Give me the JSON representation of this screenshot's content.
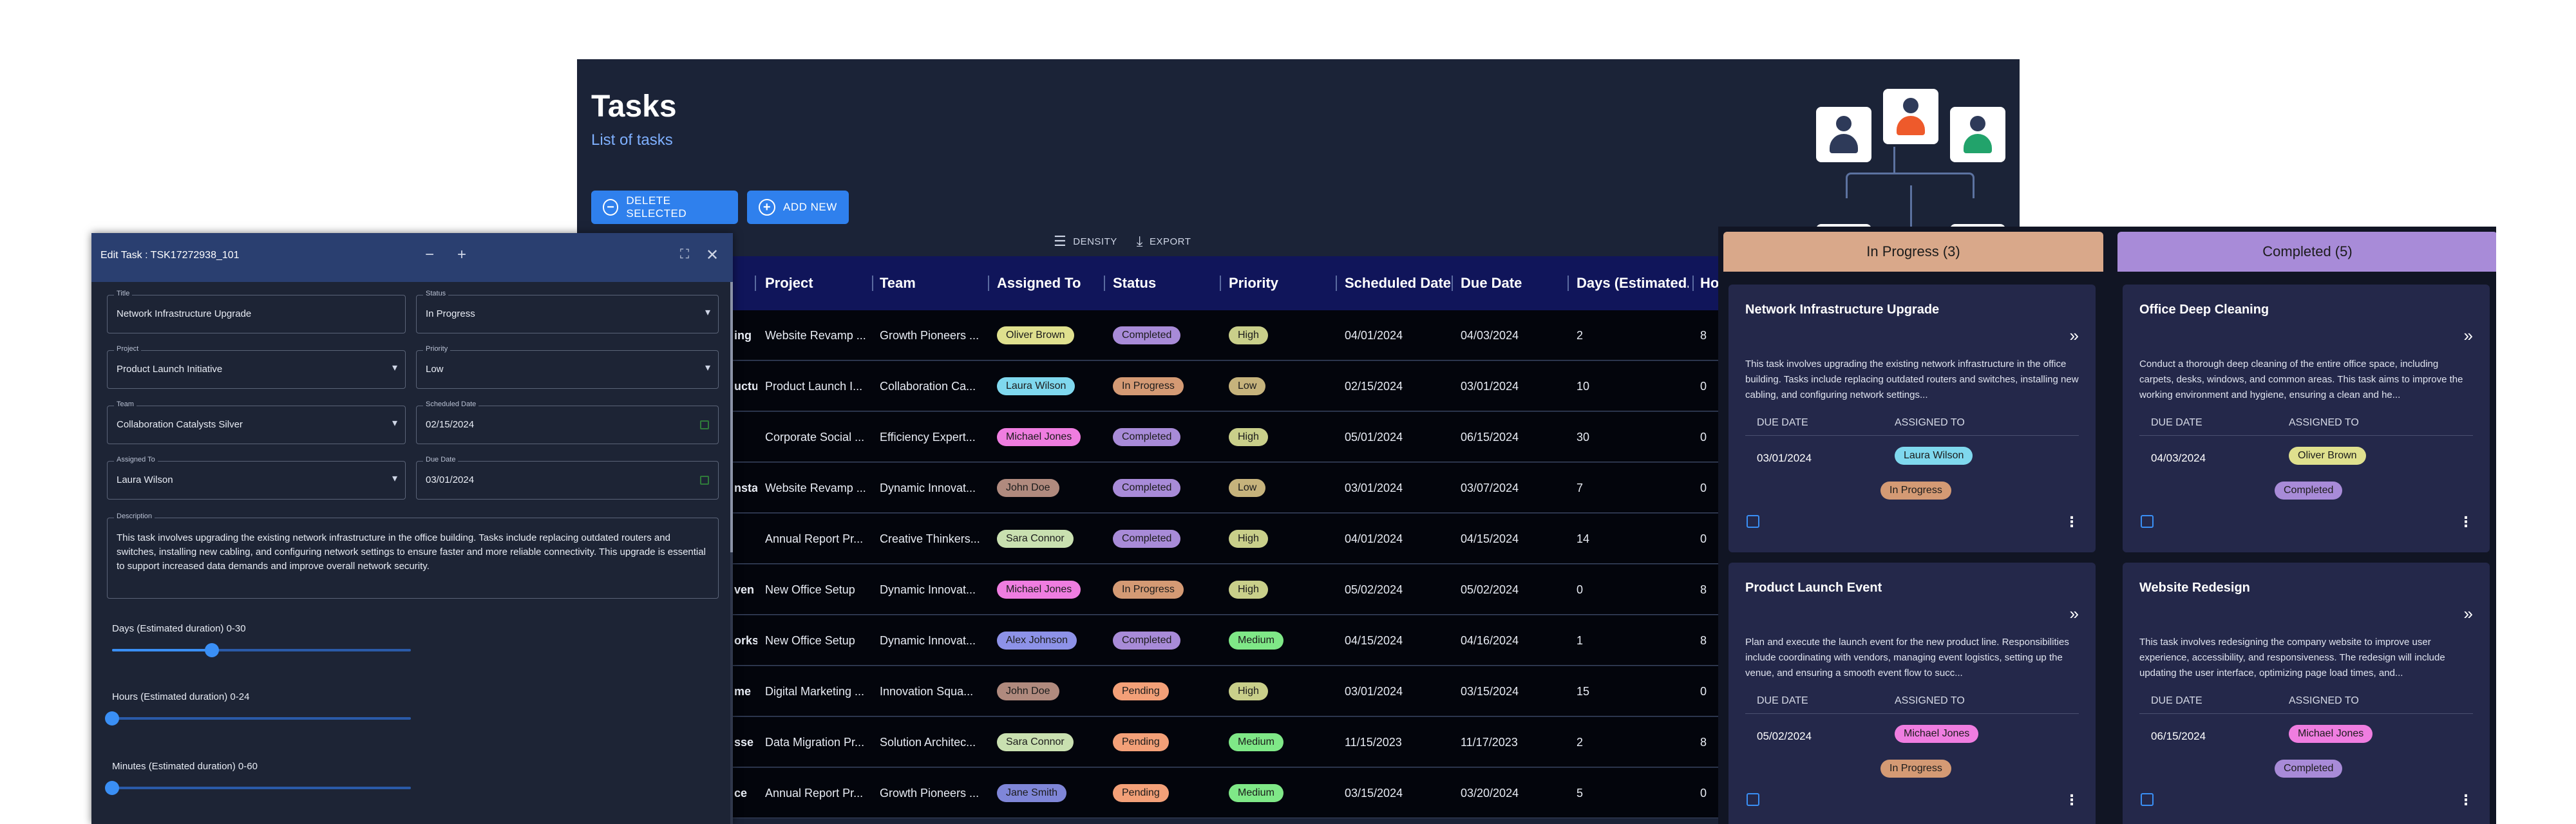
{
  "main": {
    "title": "Tasks",
    "subtitle": "List of tasks",
    "delete_button": "DELETE SELECTED",
    "add_button": "ADD NEW",
    "toolbar": {
      "density": "DENSITY",
      "export": "EXPORT"
    },
    "columns": [
      "Project",
      "Team",
      "Assigned To",
      "Status",
      "Priority",
      "Scheduled Date",
      "Due Date",
      "Days (Estimated...",
      "Hou"
    ],
    "rows": [
      {
        "name": "ing",
        "project": "Website Revamp ...",
        "team": "Growth Pioneers ...",
        "assigned": "Oliver Brown",
        "status": "Completed",
        "priority": "High",
        "scheduled": "04/01/2024",
        "due": "04/03/2024",
        "days": "2",
        "hours": "8"
      },
      {
        "name": "uctu",
        "project": "Product Launch I...",
        "team": "Collaboration Ca...",
        "assigned": "Laura Wilson",
        "status": "In Progress",
        "priority": "Low",
        "scheduled": "02/15/2024",
        "due": "03/01/2024",
        "days": "10",
        "hours": "0"
      },
      {
        "name": "",
        "project": "Corporate Social ...",
        "team": "Efficiency Expert...",
        "assigned": "Michael Jones",
        "status": "Completed",
        "priority": "High",
        "scheduled": "05/01/2024",
        "due": "06/15/2024",
        "days": "30",
        "hours": "0"
      },
      {
        "name": "nsta",
        "project": "Website Revamp ...",
        "team": "Dynamic Innovat...",
        "assigned": "John Doe",
        "status": "Completed",
        "priority": "Low",
        "scheduled": "03/01/2024",
        "due": "03/07/2024",
        "days": "7",
        "hours": "0"
      },
      {
        "name": "",
        "project": "Annual Report Pr...",
        "team": "Creative Thinkers...",
        "assigned": "Sara Connor",
        "status": "Completed",
        "priority": "High",
        "scheduled": "04/01/2024",
        "due": "04/15/2024",
        "days": "14",
        "hours": "0"
      },
      {
        "name": "ven",
        "project": "New Office Setup",
        "team": "Dynamic Innovat...",
        "assigned": "Michael Jones",
        "status": "In Progress",
        "priority": "High",
        "scheduled": "05/02/2024",
        "due": "05/02/2024",
        "days": "0",
        "hours": "8"
      },
      {
        "name": "orks",
        "project": "New Office Setup",
        "team": "Dynamic Innovat...",
        "assigned": "Alex Johnson",
        "status": "Completed",
        "priority": "Medium",
        "scheduled": "04/15/2024",
        "due": "04/16/2024",
        "days": "1",
        "hours": "8"
      },
      {
        "name": "me",
        "project": "Digital Marketing ...",
        "team": "Innovation Squa...",
        "assigned": "John Doe",
        "status": "Pending",
        "priority": "High",
        "scheduled": "03/01/2024",
        "due": "03/15/2024",
        "days": "15",
        "hours": "0"
      },
      {
        "name": "sse",
        "project": "Data Migration Pr...",
        "team": "Solution Architec...",
        "assigned": "Sara Connor",
        "status": "Pending",
        "priority": "Medium",
        "scheduled": "11/15/2023",
        "due": "11/17/2023",
        "days": "2",
        "hours": "8"
      },
      {
        "name": "ce",
        "project": "Annual Report Pr...",
        "team": "Growth Pioneers ...",
        "assigned": "Jane Smith",
        "status": "Pending",
        "priority": "Medium",
        "scheduled": "03/15/2024",
        "due": "03/20/2024",
        "days": "5",
        "hours": "0"
      }
    ]
  },
  "colors": {
    "people": {
      "Oliver Brown": "#dfe08e",
      "Laura Wilson": "#7fd8ee",
      "Michael Jones": "#ef7de0",
      "John Doe": "#b08a7e",
      "Sara Connor": "#c9e0b0",
      "Alex Johnson": "#8d92e8",
      "Jane Smith": "#7f86d8"
    },
    "status": {
      "Completed": "#a88bd8",
      "In Progress": "#d49a74",
      "Pending": "#f3a078"
    },
    "priority": {
      "High": "#c9cf8a",
      "Low": "#c6b37c",
      "Medium": "#7fe887"
    }
  },
  "dialog": {
    "title": "Edit Task : TSK17272938_101",
    "fields": {
      "title_label": "Title",
      "title_value": "Network Infrastructure Upgrade",
      "status_label": "Status",
      "status_value": "In Progress",
      "project_label": "Project",
      "project_value": "Product Launch Initiative",
      "priority_label": "Priority",
      "priority_value": "Low",
      "team_label": "Team",
      "team_value": "Collaboration Catalysts Silver",
      "scheduled_label": "Scheduled Date",
      "scheduled_value": "02/15/2024",
      "assigned_label": "Assigned To",
      "assigned_value": "Laura Wilson",
      "due_label": "Due Date",
      "due_value": "03/01/2024",
      "description_label": "Description",
      "description_value": "This task involves upgrading the existing network infrastructure in the office building. Tasks include replacing outdated routers and switches, installing new cabling, and configuring network settings to ensure faster and more reliable connectivity. This upgrade is essential to support increased data demands and improve overall network security."
    },
    "sliders": [
      {
        "label": "Days (Estimated duration) 0-30",
        "value": 10,
        "max": 30
      },
      {
        "label": "Hours (Estimated duration) 0-24",
        "value": 0,
        "max": 24
      },
      {
        "label": "Minutes (Estimated duration) 0-60",
        "value": 0,
        "max": 60
      }
    ]
  },
  "kanban": {
    "due_header": "DUE DATE",
    "assigned_header": "ASSIGNED TO",
    "columns": [
      {
        "title": "In Progress (3)",
        "color": "#d9a88a",
        "cards": [
          {
            "title": "Network Infrastructure Upgrade",
            "desc": "This task involves upgrading the existing network infrastructure in the office building. Tasks include replacing outdated routers and switches, installing new cabling, and configuring network settings...",
            "due": "03/01/2024",
            "assigned": "Laura Wilson",
            "status": "In Progress"
          },
          {
            "title": "Product Launch Event",
            "desc": "Plan and execute the launch event for the new product line. Responsibilities include coordinating with vendors, managing event logistics, setting up the venue, and ensuring a smooth event flow to succ...",
            "due": "05/02/2024",
            "assigned": "Michael Jones",
            "status": "In Progress"
          }
        ]
      },
      {
        "title": "Completed (5)",
        "color": "#a88bd8",
        "cards": [
          {
            "title": "Office Deep Cleaning",
            "desc": "Conduct a thorough deep cleaning of the entire office space, including carpets, desks, windows, and common areas. This task aims to improve the working environment and hygiene, ensuring a clean and he...",
            "due": "04/03/2024",
            "assigned": "Oliver Brown",
            "status": "Completed"
          },
          {
            "title": "Website Redesign",
            "desc": "This task involves redesigning the company website to improve user experience, accessibility, and responsiveness. The redesign will include updating the user interface, optimizing page load times, and...",
            "due": "06/15/2024",
            "assigned": "Michael Jones",
            "status": "Completed"
          }
        ]
      }
    ]
  }
}
